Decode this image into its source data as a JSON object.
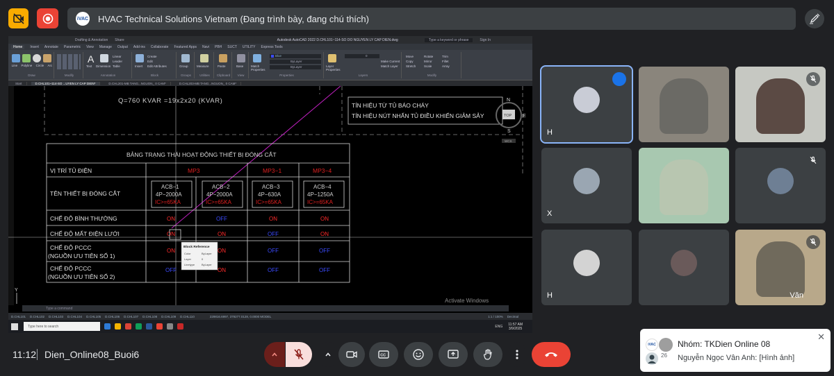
{
  "presenter": {
    "avatar_text": "iVAC",
    "title": "HVAC Technical Solutions Vietnam (Đang trình bày, đang chú thích)"
  },
  "autocad": {
    "app_title": "Autodesk AutoCAD 2022   D.CHL101~114-SO DO NGUYEN LY CAP DIEN.dwg",
    "search_placeholder": "Type a keyword or phrase",
    "sign_in": "Sign In",
    "share": "Share",
    "workspace": "Drafting & Annotation",
    "ribbon_tabs": [
      "Home",
      "Insert",
      "Annotate",
      "Parametric",
      "View",
      "Manage",
      "Output",
      "Add-ins",
      "Collaborate",
      "Featured Apps",
      "Navi",
      "PBH",
      "SUCT",
      "UTILITY",
      "Express Tools"
    ],
    "ribbon_groups": [
      "Draw",
      "Modify",
      "Annotation",
      "Block",
      "Groups",
      "Utilities",
      "Clipboard",
      "View",
      "Properties",
      "Layers",
      "Modify"
    ],
    "ribbon_buttons": {
      "line": "Line",
      "polyline": "Polyline",
      "circle": "Circle",
      "arc": "Arc",
      "text": "Text",
      "dimension": "Dimension",
      "linear": "Linear",
      "leader": "Leader",
      "table": "Table",
      "insert": "Insert",
      "create": "Create",
      "edit": "Edit",
      "edit_attributes": "Edit Attributes",
      "group": "Group",
      "measure": "Measure",
      "paste": "Paste",
      "base": "Base",
      "match_properties": "Match Properties",
      "layer_properties": "Layer Properties",
      "make_current": "Make Current",
      "match_layer": "Match Layer",
      "move": "Move",
      "copy": "Copy",
      "stretch": "Stretch",
      "rotate": "Rotate",
      "mirror": "Mirror",
      "scale": "Scale",
      "trim": "Trim",
      "fillet": "Fillet",
      "array": "Array",
      "color_value": "Blue",
      "linetype_value": "ByLayer",
      "lineweight_value": "ByLayer",
      "layer_value": "0"
    },
    "file_tabs": [
      "Start",
      "D.CHL101~114-SO ...UYEN LY CAP DIEN*",
      "D.CHL201-MB TANG...NGUON_ 0 CAM*",
      "D.CHL203-MB TANG...NGUON_ 0 CAM*"
    ],
    "canvas": {
      "header_text": "Q=760  KVAR  =19x2x20  (KVAR)",
      "note_line1": "TÍN HIỆU TỪ TỦ BÁO CHÁY",
      "note_line2": "TÍN HIỆU NÚT NHẤN TỦ ĐIỀU KHIỂN GIẢM SẢY",
      "table_title": "BẢNG TRẠNG THÁI HOẠT ĐỘNG THIẾT BỊ ĐÓNG CẮT",
      "row_position": "VỊ TRÍ TỦ ĐIỆN",
      "row_device": "TÊN THIẾT BỊ ĐÓNG CẮT",
      "row_normal": "CHẾ ĐỘ BÌNH THƯỜNG",
      "row_grid_loss": "CHẾ ĐỘ MẤT ĐIỆN LƯỚI",
      "row_pccc1_a": "CHẾ ĐỘ PCCC",
      "row_pccc1_b": "(NGUỒN ƯU TIÊN SỐ 1)",
      "row_pccc2_a": "CHẾ ĐỘ PCCC",
      "row_pccc2_b": "(NGUỒN ƯU TIÊN SỐ 2)",
      "col_mp3": "MP3",
      "col_mp3_1": "MP3−1",
      "col_mp3_4": "MP3−4",
      "acb1_a": "ACB−1",
      "acb1_b": "4P−2000A",
      "acb1_c": "IC>=65KA",
      "acb2_a": "ACB−2",
      "acb2_b": "4P−2000A",
      "acb2_c": "IC>=65KA",
      "acb3_a": "ACB−3",
      "acb3_b": "4P−630A",
      "acb3_c": "IC>=65KA",
      "acb4_a": "ACB−4",
      "acb4_b": "4P−1250A",
      "acb4_c": "IC>=65KA",
      "on": "ON",
      "off": "OFF",
      "tooltip_title": "Block Reference",
      "tooltip_color_label": "Color",
      "tooltip_color_val": "ByLayer",
      "tooltip_layer_label": "Layer",
      "tooltip_layer_val": "0",
      "tooltip_linetype_label": "Linetype",
      "tooltip_linetype_val": "ByLayer",
      "viewcube_n": "N",
      "viewcube_s": "S",
      "viewcube_e": "E",
      "viewcube_top": "TOP",
      "wcs": "WCS",
      "activate_windows": "Activate Windows",
      "y_axis": "Y"
    },
    "command_prompt": "Type a command",
    "layout_tabs": [
      "D.CHL101",
      "D.CHL102",
      "D.CHL103",
      "D.CHL104",
      "D.CHL105",
      "D.CHL106",
      "D.CHL107",
      "D.CHL108",
      "D.CHL109",
      "D.CHL110"
    ],
    "coords": "229816.6997, 379277.0128, 0.0000  MODEL",
    "scale": "1:1 / 100%",
    "units": "Decimal",
    "taskbar_search": "Type here to search",
    "lang": "ENG",
    "time": "11:57 AM",
    "date": "3/9/2025"
  },
  "participants": [
    {
      "name": "H",
      "muted": false,
      "active": true
    },
    {
      "name": "",
      "muted": false
    },
    {
      "name": "",
      "muted": true
    },
    {
      "name": "X",
      "muted": false
    },
    {
      "name": "",
      "muted": false
    },
    {
      "name": "",
      "muted": true
    },
    {
      "name": "H",
      "muted": false
    },
    {
      "name": "",
      "muted": false
    },
    {
      "name": "Văn",
      "muted": true
    }
  ],
  "bottom": {
    "clock": "11:12",
    "meeting_name": "Dien_Online08_Buoi6"
  },
  "toast": {
    "title": "Nhóm: TKDien Online 08",
    "body": "Nguyễn Ngọc Vân Anh: [Hình ảnh]",
    "count": "26",
    "close": "✕",
    "avatar_text": "iVAC"
  },
  "colors": {
    "meet_bg": "#202124",
    "tile_bg": "#3c4043",
    "hangup": "#ea4335",
    "mic_off": "#f28b82",
    "accent_blue": "#8ab4f8",
    "cad_on": "#ff2a2a",
    "cad_off": "#3b4bff"
  }
}
